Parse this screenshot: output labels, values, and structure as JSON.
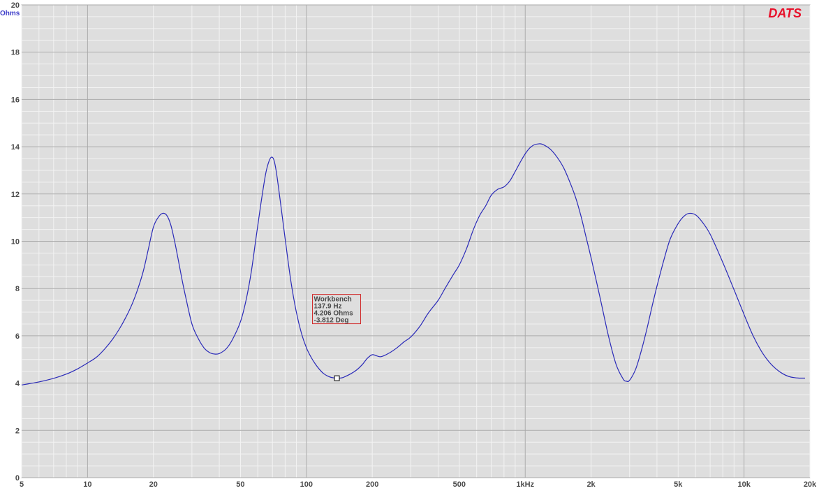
{
  "chart_data": {
    "type": "line",
    "title": "",
    "xlabel": "",
    "ylabel": "Ohms",
    "x_scale": "log",
    "xlim": [
      5,
      20000
    ],
    "ylim": [
      0,
      20
    ],
    "y_ticks": [
      0,
      2,
      4,
      6,
      8,
      10,
      12,
      14,
      16,
      18,
      20
    ],
    "x_ticks": [
      {
        "value": 5,
        "label": "5"
      },
      {
        "value": 10,
        "label": "10"
      },
      {
        "value": 20,
        "label": "20"
      },
      {
        "value": 50,
        "label": "50"
      },
      {
        "value": 100,
        "label": "100"
      },
      {
        "value": 200,
        "label": "200"
      },
      {
        "value": 500,
        "label": "500"
      },
      {
        "value": 1000,
        "label": "1kHz"
      },
      {
        "value": 2000,
        "label": "2k"
      },
      {
        "value": 5000,
        "label": "5k"
      },
      {
        "value": 10000,
        "label": "10k"
      },
      {
        "value": 20000,
        "label": "20k"
      }
    ],
    "grid": true,
    "series": [
      {
        "color": "#2a2ab8",
        "points": [
          [
            5,
            3.92
          ],
          [
            6,
            4.05
          ],
          [
            7,
            4.2
          ],
          [
            8,
            4.38
          ],
          [
            9,
            4.6
          ],
          [
            10,
            4.85
          ],
          [
            11,
            5.1
          ],
          [
            12,
            5.45
          ],
          [
            13,
            5.85
          ],
          [
            14,
            6.3
          ],
          [
            15,
            6.8
          ],
          [
            16,
            7.35
          ],
          [
            17,
            8.0
          ],
          [
            18,
            8.75
          ],
          [
            19,
            9.7
          ],
          [
            20,
            10.6
          ],
          [
            21,
            11.0
          ],
          [
            22,
            11.18
          ],
          [
            23,
            11.1
          ],
          [
            24,
            10.7
          ],
          [
            25,
            10.0
          ],
          [
            26,
            9.2
          ],
          [
            27,
            8.4
          ],
          [
            28,
            7.7
          ],
          [
            30,
            6.5
          ],
          [
            32,
            5.9
          ],
          [
            34,
            5.5
          ],
          [
            36,
            5.3
          ],
          [
            38,
            5.23
          ],
          [
            40,
            5.25
          ],
          [
            43,
            5.45
          ],
          [
            46,
            5.85
          ],
          [
            50,
            6.6
          ],
          [
            53,
            7.5
          ],
          [
            56,
            8.7
          ],
          [
            59,
            10.2
          ],
          [
            62,
            11.6
          ],
          [
            65,
            12.8
          ],
          [
            67,
            13.3
          ],
          [
            69,
            13.55
          ],
          [
            71,
            13.45
          ],
          [
            73,
            12.9
          ],
          [
            76,
            11.7
          ],
          [
            80,
            10.1
          ],
          [
            85,
            8.3
          ],
          [
            90,
            7.0
          ],
          [
            95,
            6.1
          ],
          [
            100,
            5.5
          ],
          [
            105,
            5.1
          ],
          [
            110,
            4.8
          ],
          [
            115,
            4.57
          ],
          [
            120,
            4.4
          ],
          [
            125,
            4.3
          ],
          [
            130,
            4.24
          ],
          [
            137.9,
            4.206
          ],
          [
            145,
            4.22
          ],
          [
            150,
            4.27
          ],
          [
            160,
            4.4
          ],
          [
            170,
            4.56
          ],
          [
            180,
            4.78
          ],
          [
            190,
            5.05
          ],
          [
            200,
            5.2
          ],
          [
            210,
            5.15
          ],
          [
            220,
            5.12
          ],
          [
            240,
            5.28
          ],
          [
            260,
            5.5
          ],
          [
            280,
            5.75
          ],
          [
            300,
            5.95
          ],
          [
            330,
            6.4
          ],
          [
            360,
            6.95
          ],
          [
            400,
            7.5
          ],
          [
            430,
            8.0
          ],
          [
            470,
            8.6
          ],
          [
            500,
            9.0
          ],
          [
            540,
            9.7
          ],
          [
            580,
            10.5
          ],
          [
            620,
            11.1
          ],
          [
            660,
            11.5
          ],
          [
            700,
            11.95
          ],
          [
            750,
            12.2
          ],
          [
            800,
            12.3
          ],
          [
            850,
            12.55
          ],
          [
            900,
            12.95
          ],
          [
            950,
            13.35
          ],
          [
            1000,
            13.7
          ],
          [
            1050,
            13.95
          ],
          [
            1100,
            14.08
          ],
          [
            1150,
            14.12
          ],
          [
            1200,
            14.1
          ],
          [
            1300,
            13.9
          ],
          [
            1400,
            13.55
          ],
          [
            1500,
            13.1
          ],
          [
            1600,
            12.5
          ],
          [
            1700,
            11.85
          ],
          [
            1800,
            11.05
          ],
          [
            1900,
            10.15
          ],
          [
            2000,
            9.3
          ],
          [
            2200,
            7.6
          ],
          [
            2400,
            6.0
          ],
          [
            2600,
            4.8
          ],
          [
            2800,
            4.18
          ],
          [
            2900,
            4.08
          ],
          [
            3000,
            4.12
          ],
          [
            3200,
            4.6
          ],
          [
            3400,
            5.4
          ],
          [
            3600,
            6.3
          ],
          [
            3800,
            7.25
          ],
          [
            4000,
            8.1
          ],
          [
            4300,
            9.2
          ],
          [
            4600,
            10.1
          ],
          [
            5000,
            10.75
          ],
          [
            5300,
            11.05
          ],
          [
            5600,
            11.18
          ],
          [
            6000,
            11.12
          ],
          [
            6400,
            10.85
          ],
          [
            7000,
            10.3
          ],
          [
            8000,
            9.1
          ],
          [
            9000,
            7.95
          ],
          [
            10000,
            6.9
          ],
          [
            11000,
            6.0
          ],
          [
            12000,
            5.35
          ],
          [
            13000,
            4.9
          ],
          [
            14000,
            4.6
          ],
          [
            15000,
            4.4
          ],
          [
            16000,
            4.28
          ],
          [
            17000,
            4.23
          ],
          [
            18000,
            4.21
          ],
          [
            19000,
            4.21
          ]
        ]
      }
    ],
    "cursor": {
      "x": 137.9,
      "y": 4.206,
      "lines": [
        "Workbench",
        "137.9 Hz",
        "4.206 Ohms",
        "-3.812 Deg"
      ]
    },
    "brand": "DATS",
    "colors": {
      "plot_background": "#dedede",
      "minor_grid": "#f3f3f3",
      "major_grid": "#a8a8a8",
      "curve": "#2a2ab8",
      "cursor_box_border": "#d02828",
      "brand": "#e8102a"
    }
  }
}
